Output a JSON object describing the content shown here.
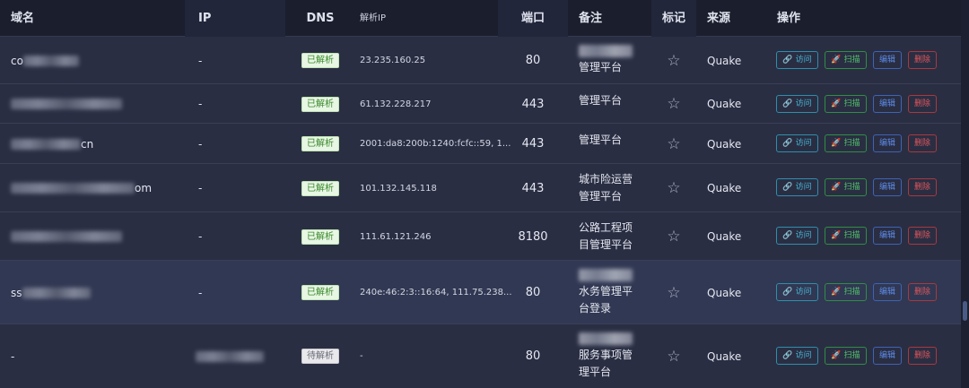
{
  "header": {
    "domain": "域名",
    "ip": "IP",
    "dns": "DNS",
    "resolved_ip": "解析IP",
    "port": "端口",
    "remark": "备注",
    "mark": "标记",
    "source": "来源",
    "actions": "操作"
  },
  "actions": {
    "visit": "访问",
    "scan": "扫描",
    "edit": "编辑",
    "delete": "删除"
  },
  "star_glyph": "☆",
  "rows": [
    {
      "domain_prefix": "co",
      "domain_suffix": "",
      "ip": "-",
      "dns": "已解析",
      "resolved_ip": "23.235.160.25",
      "port": "80",
      "remark_blur": true,
      "remark": "管理平台",
      "source": "Quake"
    },
    {
      "domain_prefix": "",
      "domain_suffix": "",
      "ip": "-",
      "dns": "已解析",
      "resolved_ip": "61.132.228.217",
      "port": "443",
      "remark_blur": false,
      "remark": "管理平台",
      "source": "Quake"
    },
    {
      "domain_prefix": "",
      "domain_suffix": "cn",
      "ip": "-",
      "dns": "已解析",
      "resolved_ip": "2001:da8:200b:1240:fcfc::59, 1...",
      "port": "443",
      "remark_blur": false,
      "remark": "管理平台",
      "source": "Quake"
    },
    {
      "domain_prefix": "",
      "domain_suffix": "om",
      "ip": "-",
      "dns": "已解析",
      "resolved_ip": "101.132.145.118",
      "port": "443",
      "remark_blur": false,
      "remark": "城市险运营管理平台",
      "source": "Quake"
    },
    {
      "domain_prefix": "",
      "domain_suffix": "",
      "ip": "-",
      "dns": "已解析",
      "resolved_ip": "111.61.121.246",
      "port": "8180",
      "remark_blur": false,
      "remark": "公路工程项目管理平台",
      "source": "Quake"
    },
    {
      "domain_prefix": "ss",
      "domain_suffix": "",
      "ip": "-",
      "dns": "已解析",
      "resolved_ip": "240e:46:2:3::16:64, 111.75.238...",
      "port": "80",
      "remark_blur": true,
      "remark": "水务管理平台登录",
      "source": "Quake"
    },
    {
      "domain_prefix": "-",
      "domain_suffix": "",
      "ip": "",
      "dns": "待解析",
      "resolved_ip": "-",
      "port": "80",
      "remark_blur": true,
      "remark": "服务事项管理平台",
      "source": "Quake"
    }
  ]
}
